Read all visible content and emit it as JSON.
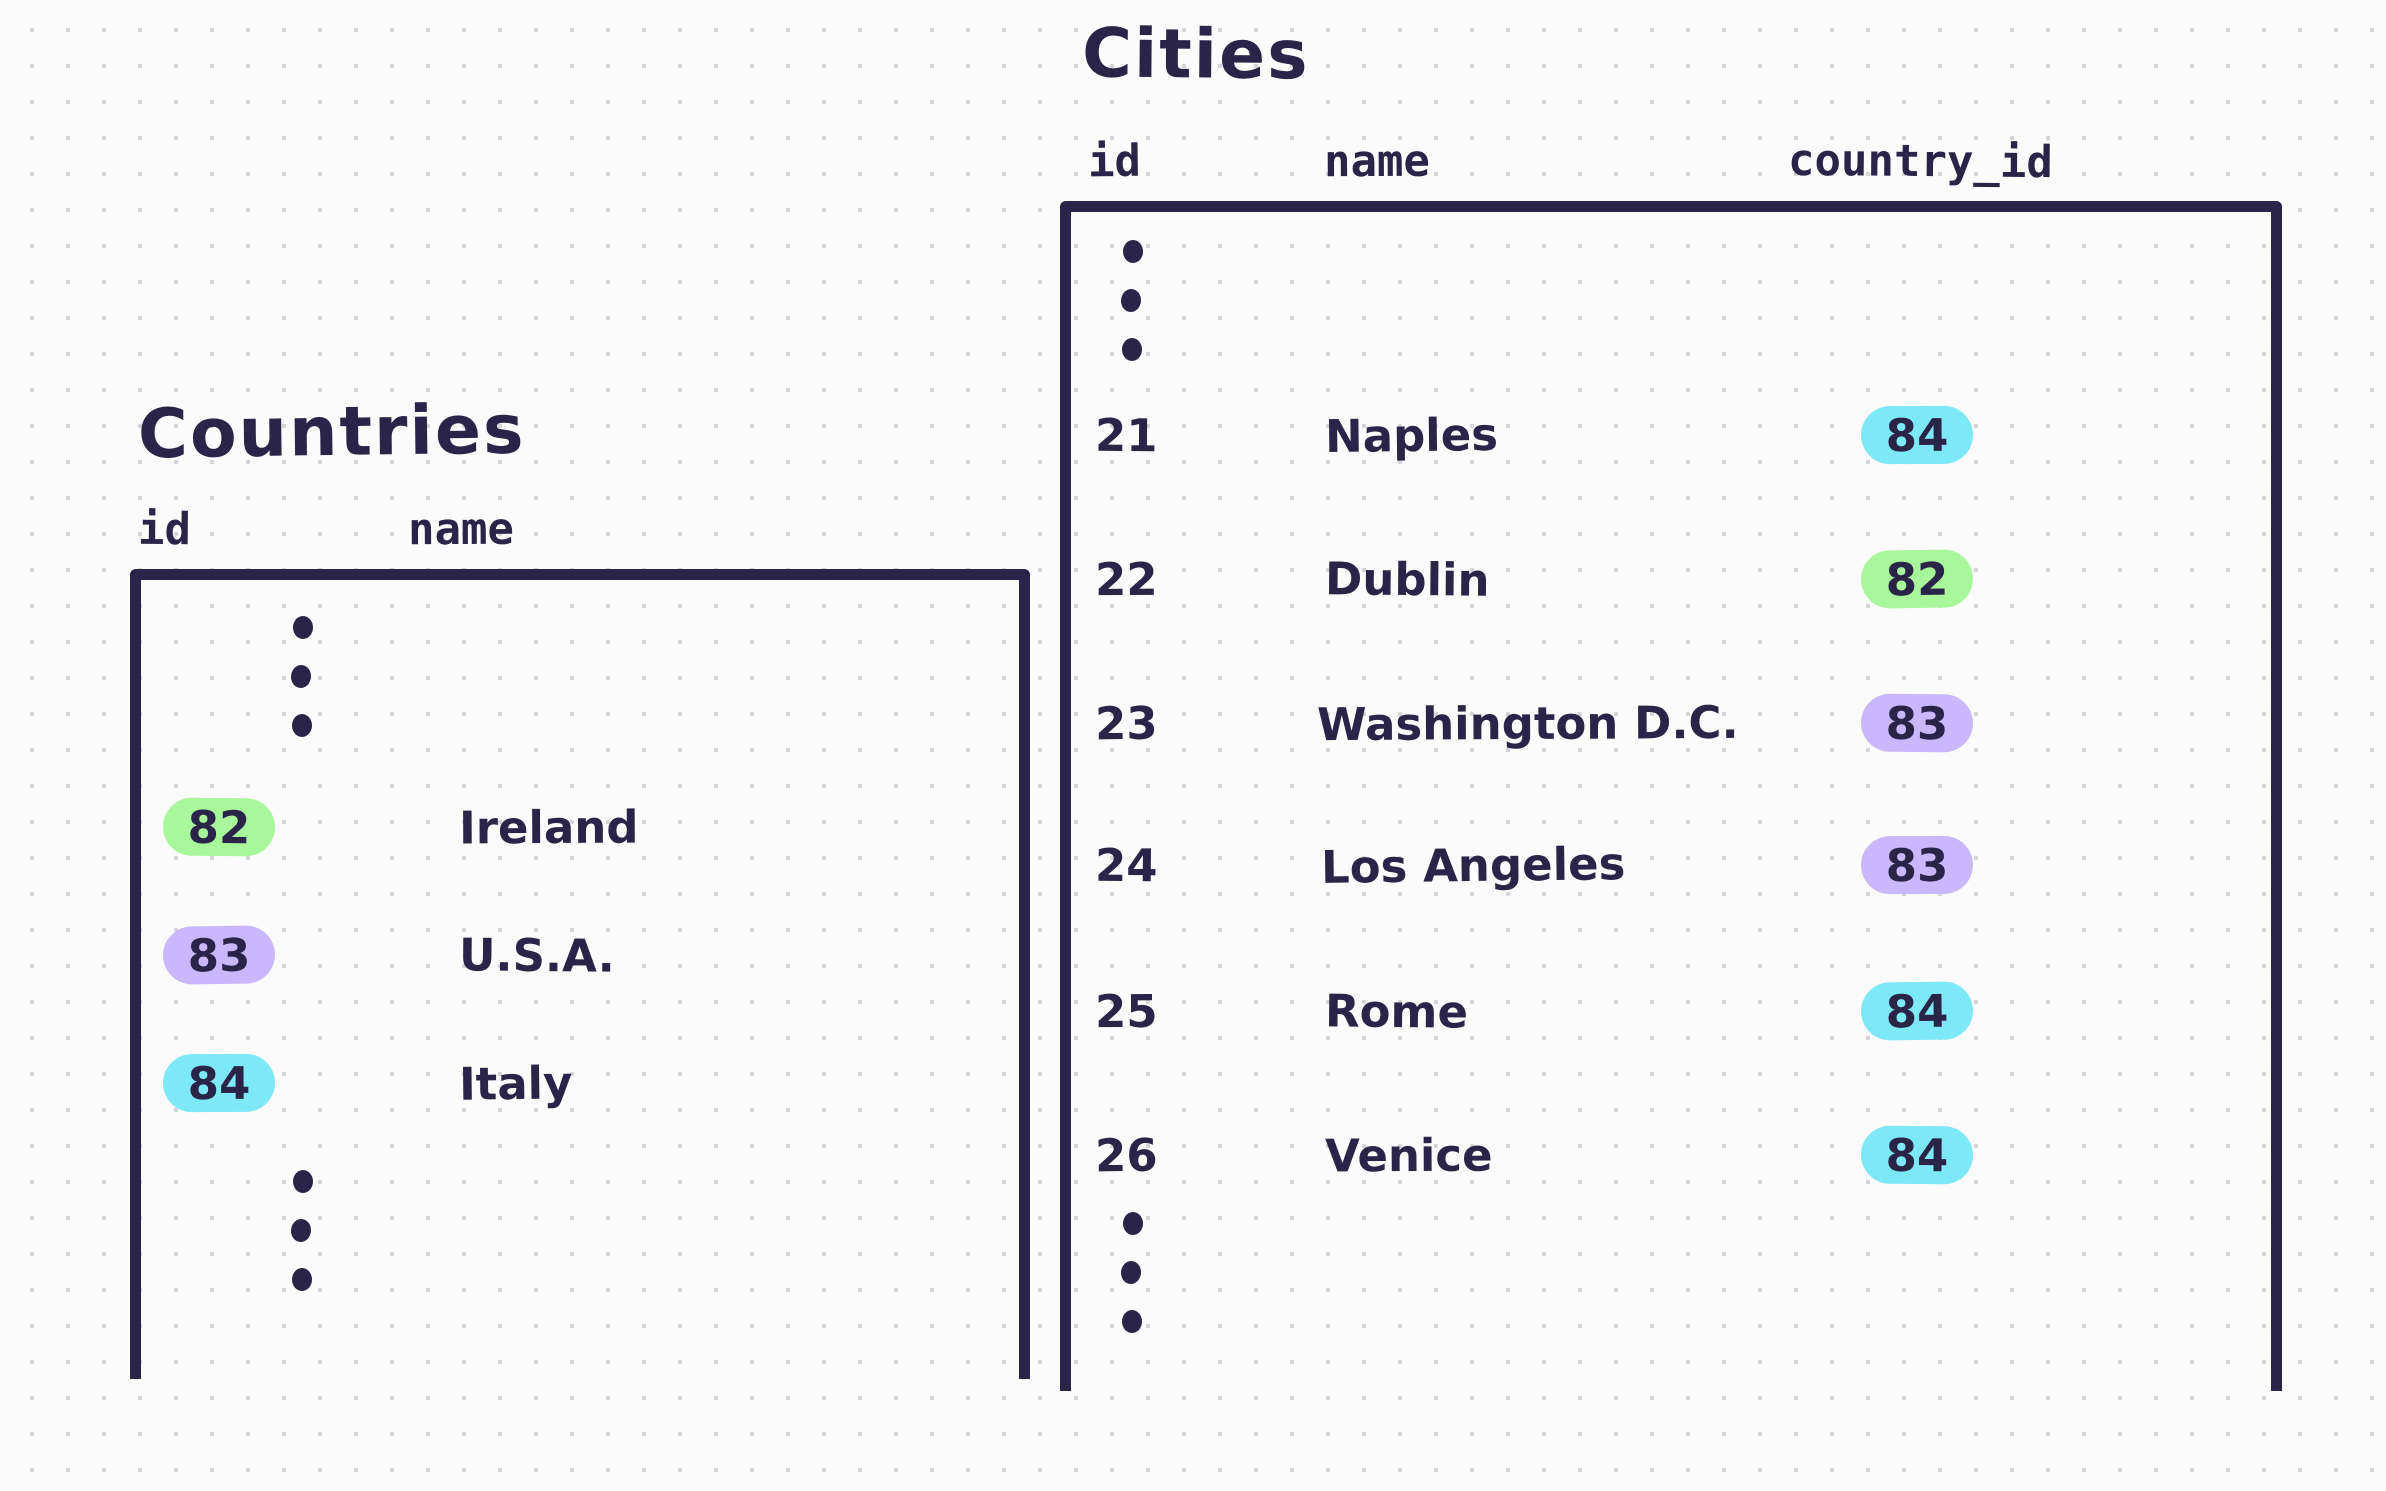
{
  "canvas": {
    "background": "#fbfbfb",
    "dot_color": "#d3d3d8",
    "ink": "#2a2449"
  },
  "palette": {
    "green": "#a8f79a",
    "purple": "#c9b8fd",
    "cyan": "#7de8f7"
  },
  "countries": {
    "title": "Countries",
    "columns": [
      {
        "label": "id"
      },
      {
        "label": "name"
      }
    ],
    "leading_ellipsis": true,
    "trailing_ellipsis": true,
    "rows": [
      {
        "id": "82",
        "id_color": "#a8f79a",
        "name": "Ireland"
      },
      {
        "id": "83",
        "id_color": "#c9b8fd",
        "name": "U.S.A."
      },
      {
        "id": "84",
        "id_color": "#7de8f7",
        "name": "Italy"
      }
    ]
  },
  "cities": {
    "title": "Cities",
    "columns": [
      {
        "label": "id"
      },
      {
        "label": "name"
      },
      {
        "label": "country_id"
      }
    ],
    "leading_ellipsis": true,
    "trailing_ellipsis": true,
    "rows": [
      {
        "id": "21",
        "name": "Naples",
        "country_id": "84",
        "country_id_color": "#7de8f7"
      },
      {
        "id": "22",
        "name": "Dublin",
        "country_id": "82",
        "country_id_color": "#a8f79a"
      },
      {
        "id": "23",
        "name": "Washington D.C.",
        "country_id": "83",
        "country_id_color": "#c9b8fd"
      },
      {
        "id": "24",
        "name": "Los Angeles",
        "country_id": "83",
        "country_id_color": "#c9b8fd"
      },
      {
        "id": "25",
        "name": "Rome",
        "country_id": "84",
        "country_id_color": "#7de8f7"
      },
      {
        "id": "26",
        "name": "Venice",
        "country_id": "84",
        "country_id_color": "#7de8f7"
      }
    ]
  }
}
